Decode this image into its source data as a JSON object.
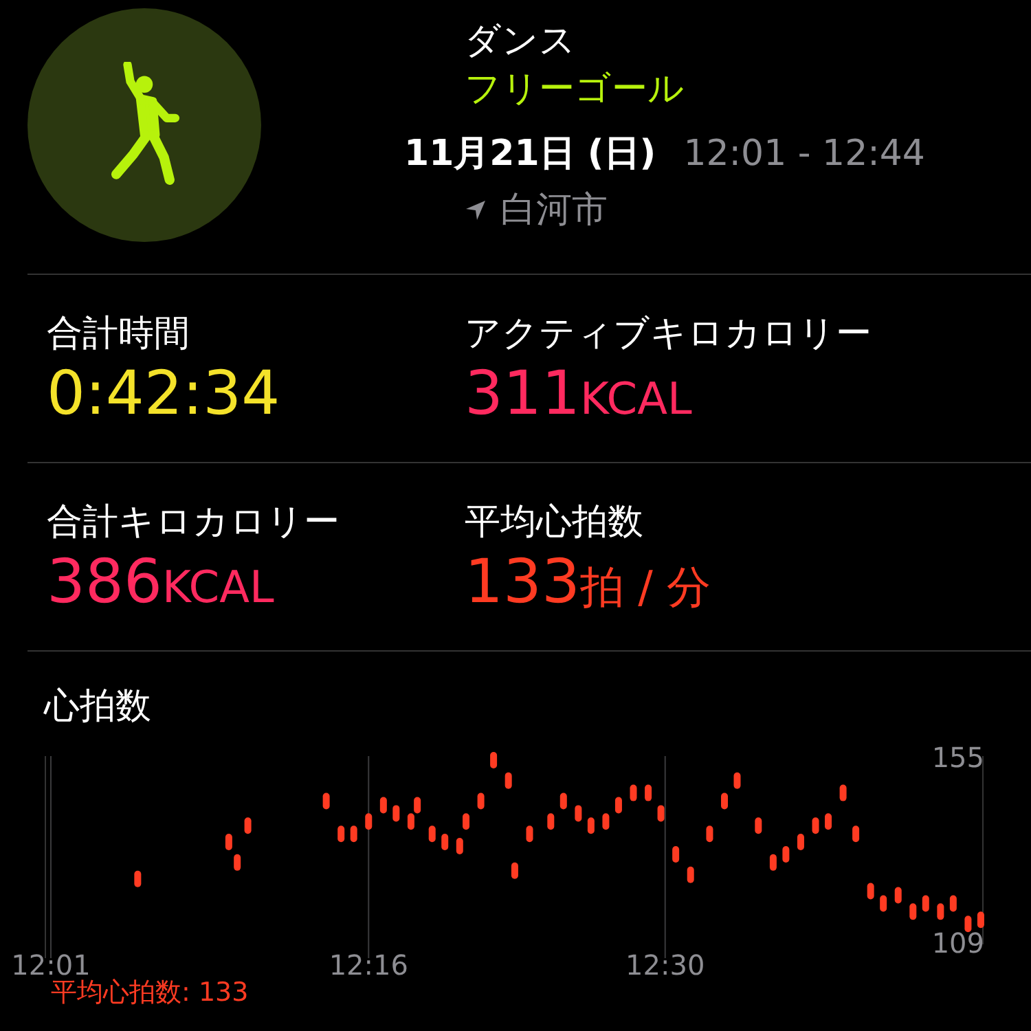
{
  "workout": {
    "name": "ダンス",
    "goal": "フリーゴール",
    "date": "11月21日 (日)",
    "time": "12:01 - 12:44",
    "location": "白河市"
  },
  "metrics": [
    {
      "label": "合計時間",
      "value": "0:42:34",
      "color": "#f4e22a"
    },
    {
      "label": "アクティブキロカロリー",
      "value": "311",
      "unit": "KCAL",
      "color": "#ff2a5f"
    },
    {
      "label": "合計キロカロリー",
      "value": "386",
      "unit": "KCAL",
      "color": "#ff2a5f"
    },
    {
      "label": "平均心拍数",
      "value": "133",
      "unit": "拍 / 分",
      "color": "#ff3b22"
    }
  ],
  "heart_rate": {
    "title": "心拍数",
    "footer": "平均心拍数: 133",
    "chart_data": {
      "type": "scatter",
      "x": [
        725.1,
        729.4,
        729.8,
        730.3,
        734,
        734.7,
        735.3,
        736,
        736.7,
        737.3,
        738,
        738.3,
        739,
        739.6,
        740.3,
        740.6,
        741.3,
        741.9,
        742.6,
        742.9,
        743.6,
        744.6,
        745.2,
        745.9,
        746.5,
        747.2,
        747.8,
        748.5,
        749.2,
        749.8,
        750.5,
        751.2,
        752.1,
        752.8,
        753.4,
        754.4,
        755.1,
        755.7,
        756.4,
        757.1,
        757.7,
        758.4,
        759,
        759.7,
        760.3,
        761,
        761.7,
        762.3,
        763,
        763.6,
        764.3,
        764.9
      ],
      "series": [
        {
          "color": "#ff3b22",
          "values": [
            125,
            134,
            129,
            138,
            144,
            136,
            136,
            139,
            143,
            141,
            139,
            143,
            136,
            134,
            133,
            139,
            144,
            154,
            149,
            127,
            136,
            139,
            144,
            141,
            138,
            139,
            143,
            146,
            146,
            141,
            131,
            126,
            136,
            144,
            149,
            138,
            129,
            131,
            134,
            138,
            139,
            146,
            136,
            122,
            119,
            121,
            117,
            119,
            117,
            119,
            114,
            115
          ]
        }
      ],
      "xlim": [
        721,
        765
      ],
      "ylim": [
        109,
        155
      ],
      "xticks": [
        {
          "value": 721,
          "label": "12:01"
        },
        {
          "value": 736,
          "label": "12:16"
        },
        {
          "value": 750,
          "label": "12:30"
        }
      ],
      "yticks": [
        155,
        109
      ]
    }
  }
}
